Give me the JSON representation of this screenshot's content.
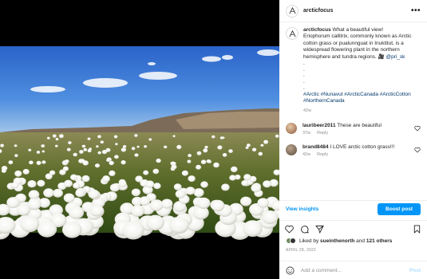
{
  "post": {
    "username": "arcticfocus",
    "caption_intro": " What a beautiful view!",
    "caption_body": "Eriophorum callitrix, commonly known as Arctic cotton grass or pualunnguat in Inuktitut, is a widespread flowering plant in the northern hemisphere and tundra regions. 🎥 ",
    "caption_mention": "@pri_sk",
    "hashtags": "#Arctic #Nunavut #ArcticCanada #ArcticCotton #NorthernCanada",
    "time": "42w",
    "likes_prefix": "Liked by ",
    "liked_by": "sueinthenorth",
    "likes_join": " and ",
    "likes_others": "121 others",
    "date": "APRIL 28, 2022"
  },
  "comments": [
    {
      "user": "lauribeer2011",
      "text": " These are beautiful",
      "time": "37w",
      "reply": "Reply"
    },
    {
      "user": "brand8484",
      "text": " I LOVE arctic cotton grass!!!",
      "time": "42w",
      "reply": "Reply"
    }
  ],
  "actions": {
    "view_insights": "View insights",
    "boost_post": "Boost post",
    "add_comment_placeholder": "Add a comment...",
    "post": "Post"
  },
  "icons": [
    "logo-icon",
    "more-icon",
    "heart-icon",
    "comment-icon",
    "share-icon",
    "save-icon",
    "emoji-icon"
  ],
  "colors": {
    "accent": "#0095f6",
    "link": "#00376b",
    "muted": "#8e8e8e"
  }
}
